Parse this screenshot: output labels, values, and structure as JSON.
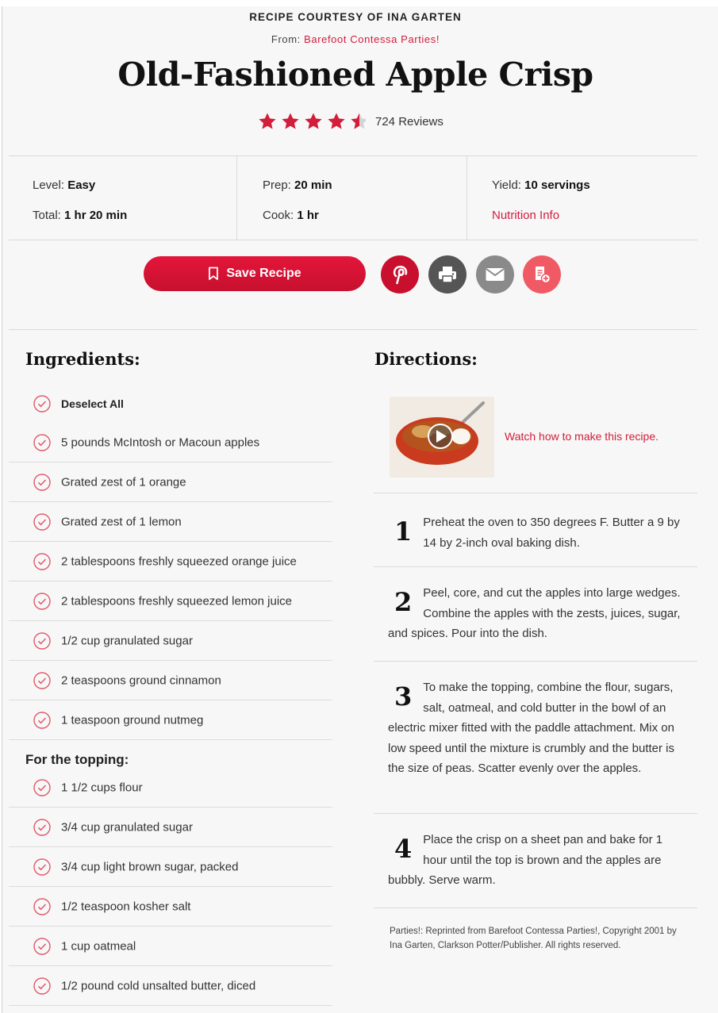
{
  "header": {
    "courtesy": "RECIPE COURTESY OF INA GARTEN",
    "from_label": "From:",
    "from_source": "Barefoot Contessa Parties!",
    "title": "Old-Fashioned Apple Crisp",
    "rating": 4.5,
    "rating_max": 5,
    "reviews": "724 Reviews"
  },
  "info": {
    "level_label": "Level:",
    "level_value": "Easy",
    "total_label": "Total:",
    "total_value": "1 hr 20 min",
    "prep_label": "Prep:",
    "prep_value": "20 min",
    "cook_label": "Cook:",
    "cook_value": "1 hr",
    "yield_label": "Yield:",
    "yield_value": "10 servings",
    "nutrition": "Nutrition Info"
  },
  "actions": {
    "save_label": "Save Recipe",
    "icons": [
      "bookmark-icon",
      "pinterest-icon",
      "print-icon",
      "email-icon",
      "add-to-list-icon"
    ]
  },
  "colors": {
    "accent": "#d21d3b",
    "pinterest": "#c8102e",
    "print": "#555555",
    "email": "#8a8a8a",
    "add": "#f05a64"
  },
  "ingredients": {
    "heading": "Ingredients:",
    "deselect": "Deselect All",
    "items": [
      "5 pounds McIntosh or Macoun apples",
      "Grated zest of 1 orange",
      "Grated zest of 1 lemon",
      "2 tablespoons freshly squeezed orange juice",
      "2 tablespoons freshly squeezed lemon juice",
      "1/2 cup granulated sugar",
      "2 teaspoons ground cinnamon",
      "1 teaspoon ground nutmeg"
    ],
    "topping_heading": "For the topping:",
    "topping_items": [
      "1 1/2 cups flour",
      "3/4 cup granulated sugar",
      "3/4 cup light brown sugar, packed",
      "1/2 teaspoon kosher salt",
      "1 cup oatmeal",
      "1/2 pound cold unsalted butter, diced"
    ]
  },
  "directions": {
    "heading": "Directions:",
    "watch": "Watch how to make this recipe.",
    "steps": [
      {
        "num": "1",
        "text": "Preheat the oven to 350 degrees F. Butter a 9 by 14 by 2-inch oval baking dish."
      },
      {
        "num": "2",
        "text": "Peel, core, and cut the apples into large wedges. Combine the apples with the zests, juices, sugar, and spices. Pour into the dish."
      },
      {
        "num": "3",
        "text": "To make the topping, combine the flour, sugars, salt, oatmeal, and cold butter in the bowl of an electric mixer fitted with the paddle attachment. Mix on low speed until the mixture is crumbly and the butter is the size of peas. Scatter evenly over the apples."
      },
      {
        "num": "4",
        "text": "Place the crisp on a sheet pan and bake for 1 hour until the top is brown and the apples are bubbly. Serve warm."
      }
    ],
    "credit": "Parties!: Reprinted from Barefoot Contessa Parties!, Copyright 2001 by Ina Garten, Clarkson Potter/Publisher. All rights reserved."
  }
}
